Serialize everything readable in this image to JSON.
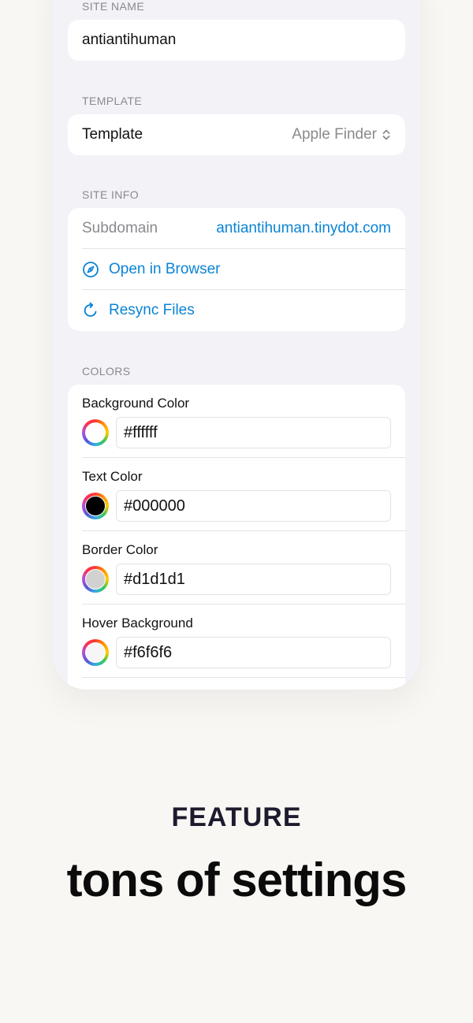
{
  "site_name": {
    "header": "SITE NAME",
    "value": "antiantihuman"
  },
  "template": {
    "header": "TEMPLATE",
    "label": "Template",
    "value": "Apple Finder",
    "chevron_icon": "chevron-up-down-icon"
  },
  "site_info": {
    "header": "SITE INFO",
    "subdomain_label": "Subdomain",
    "subdomain_value": "antiantihuman.tinydot.com",
    "open_browser_label": "Open in Browser",
    "open_browser_icon": "compass-icon",
    "resync_label": "Resync Files",
    "resync_icon": "refresh-icon"
  },
  "colors": {
    "header": "COLORS",
    "items": [
      {
        "label": "Background Color",
        "value": "#ffffff",
        "swatch": "#ffffff"
      },
      {
        "label": "Text Color",
        "value": "#000000",
        "swatch": "#000000"
      },
      {
        "label": "Border Color",
        "value": "#d1d1d1",
        "swatch": "#d1d1d1"
      },
      {
        "label": "Hover Background",
        "value": "#f6f6f6",
        "swatch": "#f6f6f6"
      }
    ]
  },
  "marketing": {
    "feature_label": "FEATURE",
    "headline": "tons of settings"
  },
  "theme": {
    "accent": "#0a84d6",
    "page_background": "#f9f7f3",
    "panel_background": "#f2f2f7"
  }
}
